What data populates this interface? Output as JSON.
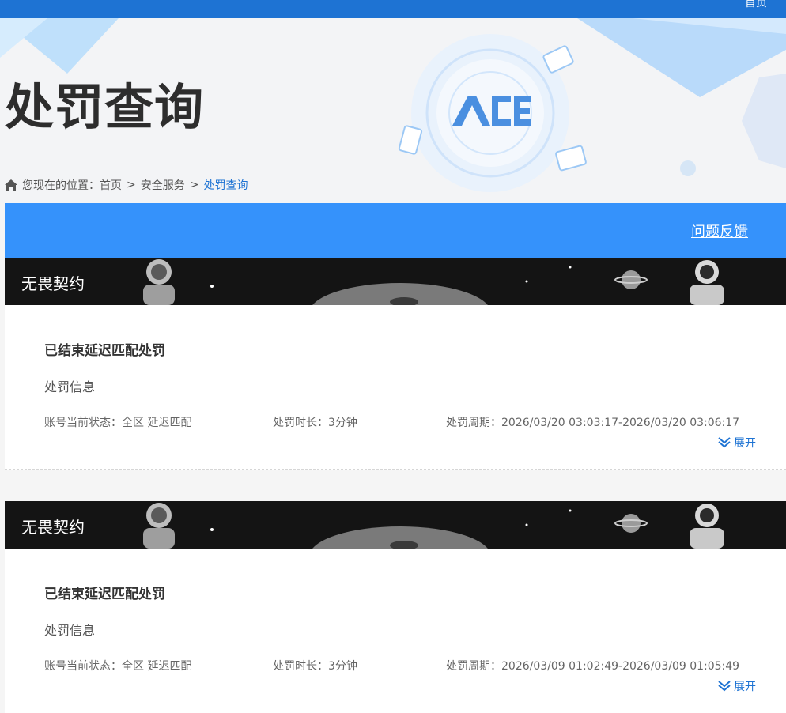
{
  "topbar": {
    "home_label": "首页"
  },
  "hero": {
    "title": "处罚查询",
    "logo_text": "ACE",
    "breadcrumb": {
      "prefix": "您现在的位置：",
      "items": [
        "首页",
        "安全服务",
        "处罚查询"
      ],
      "separator": ">"
    }
  },
  "feedback": {
    "label": "问题反馈"
  },
  "records": [
    {
      "game": "无畏契约",
      "status_title": "已结束延迟匹配处罚",
      "info_label": "处罚信息",
      "state": "账号当前状态：全区 延迟匹配",
      "duration": "处罚时长：3分钟",
      "period": "处罚周期：2026/03/20 03:03:17-2026/03/20 03:06:17",
      "expand_label": "展开"
    },
    {
      "game": "无畏契约",
      "status_title": "已结束延迟匹配处罚",
      "info_label": "处罚信息",
      "state": "账号当前状态：全区 延迟匹配",
      "duration": "处罚时长：3分钟",
      "period": "处罚周期：2026/03/09 01:02:49-2026/03/09 01:05:49",
      "expand_label": "展开"
    }
  ],
  "colors": {
    "brand_blue": "#1e73d3",
    "bar_blue": "#3592fb",
    "banner_bg": "#141414"
  }
}
